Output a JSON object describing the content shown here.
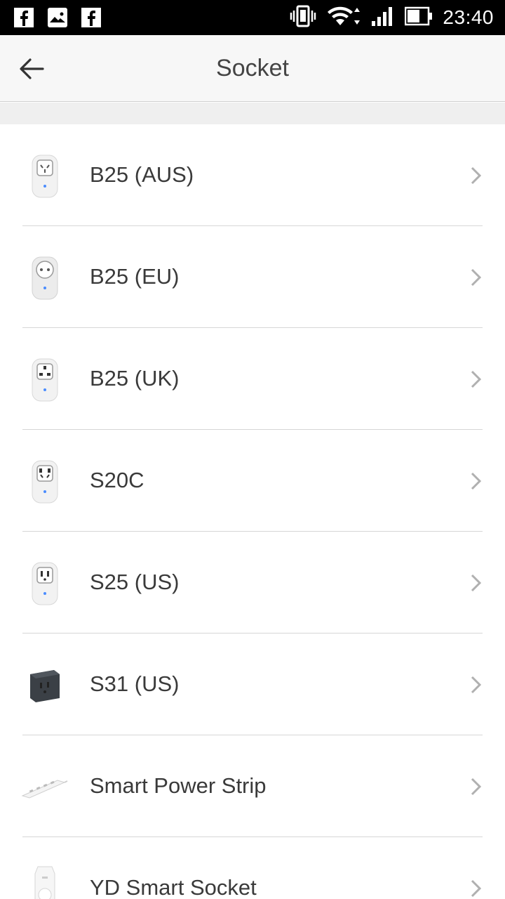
{
  "status_bar": {
    "time": "23:40",
    "left_icons": [
      "facebook-icon",
      "gallery-icon",
      "facebook-icon"
    ],
    "right_icons": [
      "vibrate-icon",
      "wifi-icon",
      "signal-icon",
      "battery-icon"
    ]
  },
  "app_bar": {
    "title": "Socket",
    "back_icon": "arrow-left-icon"
  },
  "devices": [
    {
      "label": "B25 (AUS)",
      "icon": "socket-aus-icon"
    },
    {
      "label": "B25 (EU)",
      "icon": "socket-eu-icon"
    },
    {
      "label": "B25 (UK)",
      "icon": "socket-uk-icon"
    },
    {
      "label": "S20C",
      "icon": "socket-s20c-icon"
    },
    {
      "label": "S25 (US)",
      "icon": "socket-us-icon"
    },
    {
      "label": "S31 (US)",
      "icon": "socket-s31-icon"
    },
    {
      "label": "Smart Power Strip",
      "icon": "power-strip-icon"
    },
    {
      "label": "YD Smart Socket",
      "icon": "yd-socket-icon"
    }
  ],
  "colors": {
    "status_bar": "#000000",
    "app_bar": "#f7f7f7",
    "separator_band": "#efefef",
    "divider": "#d6d6d6",
    "text": "#3a3a3a",
    "chevron": "#b0b0b0"
  }
}
